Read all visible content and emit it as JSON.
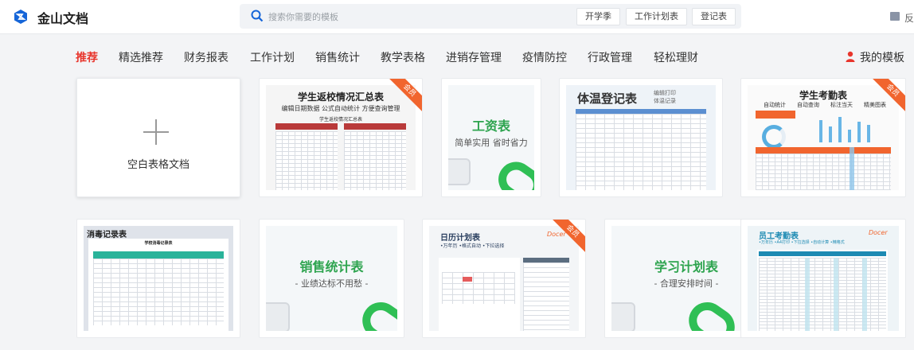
{
  "header": {
    "app_title": "金山文档",
    "search_placeholder": "搜索你需要的模板",
    "search_tags": [
      "开学季",
      "工作计划表",
      "登记表"
    ],
    "feedback": "反"
  },
  "nav": {
    "items": [
      "推荐",
      "精选推荐",
      "财务报表",
      "工作计划",
      "销售统计",
      "教学表格",
      "进销存管理",
      "疫情防控",
      "行政管理",
      "轻松理财"
    ],
    "active_index": 0,
    "my_templates": "我的模板"
  },
  "cards": {
    "blank_label": "空白表格文档",
    "member_badge": "会员",
    "c1": {
      "title": "学生返校情况汇总表",
      "sub": "编辑日期数据  公式自动统计  方便查询管理",
      "inner": "学生返校情况汇总表"
    },
    "c2": {
      "title": "工资表",
      "sub": "简单实用 省时省力"
    },
    "c3": {
      "title": "体温登记表",
      "meta1": "编辑打印",
      "meta2": "体温记录"
    },
    "c4": {
      "title": "学生考勤表",
      "tags": [
        "自动统计",
        "自动查询",
        "标注当天",
        "精美图表"
      ]
    },
    "c5": {
      "title": "消毒记录表",
      "inner": "学校消毒记录表"
    },
    "c6": {
      "title": "销售统计表",
      "sub": "- 业绩达标不用愁 -"
    },
    "c7": {
      "title": "日历计划表",
      "sub": "•万年历  •格式自动  •下拉选择",
      "brand": "Docer"
    },
    "c8": {
      "title": "学习计划表",
      "sub": "- 合理安排时间 -"
    },
    "c9": {
      "title": "员工考勤表",
      "sub": "•万年历  •A4打印  •下拉选择  •自动计算  •精格式",
      "brand": "Docer"
    }
  },
  "colors": {
    "accent_red": "#e8352c",
    "brand_blue": "#1565d8",
    "green": "#2ea44f",
    "member_orange": "#f1652e"
  }
}
